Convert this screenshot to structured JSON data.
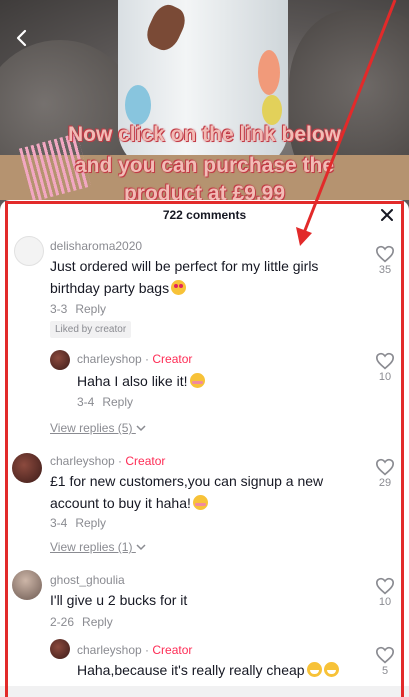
{
  "video": {
    "back_icon": "chevron-left-icon",
    "overlay_lines": [
      "Now click on the link below",
      "and you can purchase the",
      "product at £9.99"
    ]
  },
  "comments_panel": {
    "count_label": "722 comments",
    "close_icon": "close-icon",
    "like_icon": "heart-outline-icon",
    "comments": [
      {
        "username": "delisharoma2020",
        "text": "Just ordered will be perfect for my little girls birthday party bags",
        "emoji": "smiling-face-with-heart-eyes",
        "date": "3-3",
        "reply_label": "Reply",
        "likes": "35",
        "liked_by_creator": "Liked by creator",
        "replies": [
          {
            "username": "charleyshop",
            "creator_label": "Creator",
            "text": "Haha I also like it!",
            "emoji": "smiling-face-with-hearts",
            "date": "3-4",
            "reply_label": "Reply",
            "likes": "10"
          }
        ],
        "view_replies": "View replies (5)"
      },
      {
        "username": "charleyshop",
        "creator_label": "Creator",
        "text": "£1 for new customers,you can signup a new account to buy it haha!",
        "emoji": "smiling-face-with-hearts",
        "date": "3-4",
        "reply_label": "Reply",
        "likes": "29",
        "view_replies": "View replies (1)"
      },
      {
        "username": "ghost_ghoulia",
        "text": "I'll give u 2 bucks for it",
        "date": "2-26",
        "reply_label": "Reply",
        "likes": "10",
        "replies": [
          {
            "username": "charleyshop",
            "creator_label": "Creator",
            "text": "Haha,because it's really really cheap",
            "emoji": "grinning-face-with-sweat",
            "likes": "5"
          }
        ]
      }
    ]
  },
  "colors": {
    "accent_creator": "#fe2c55",
    "highlight_frame": "#e22a2a",
    "muted_text": "#8a8b91",
    "primary_text": "#161823"
  }
}
